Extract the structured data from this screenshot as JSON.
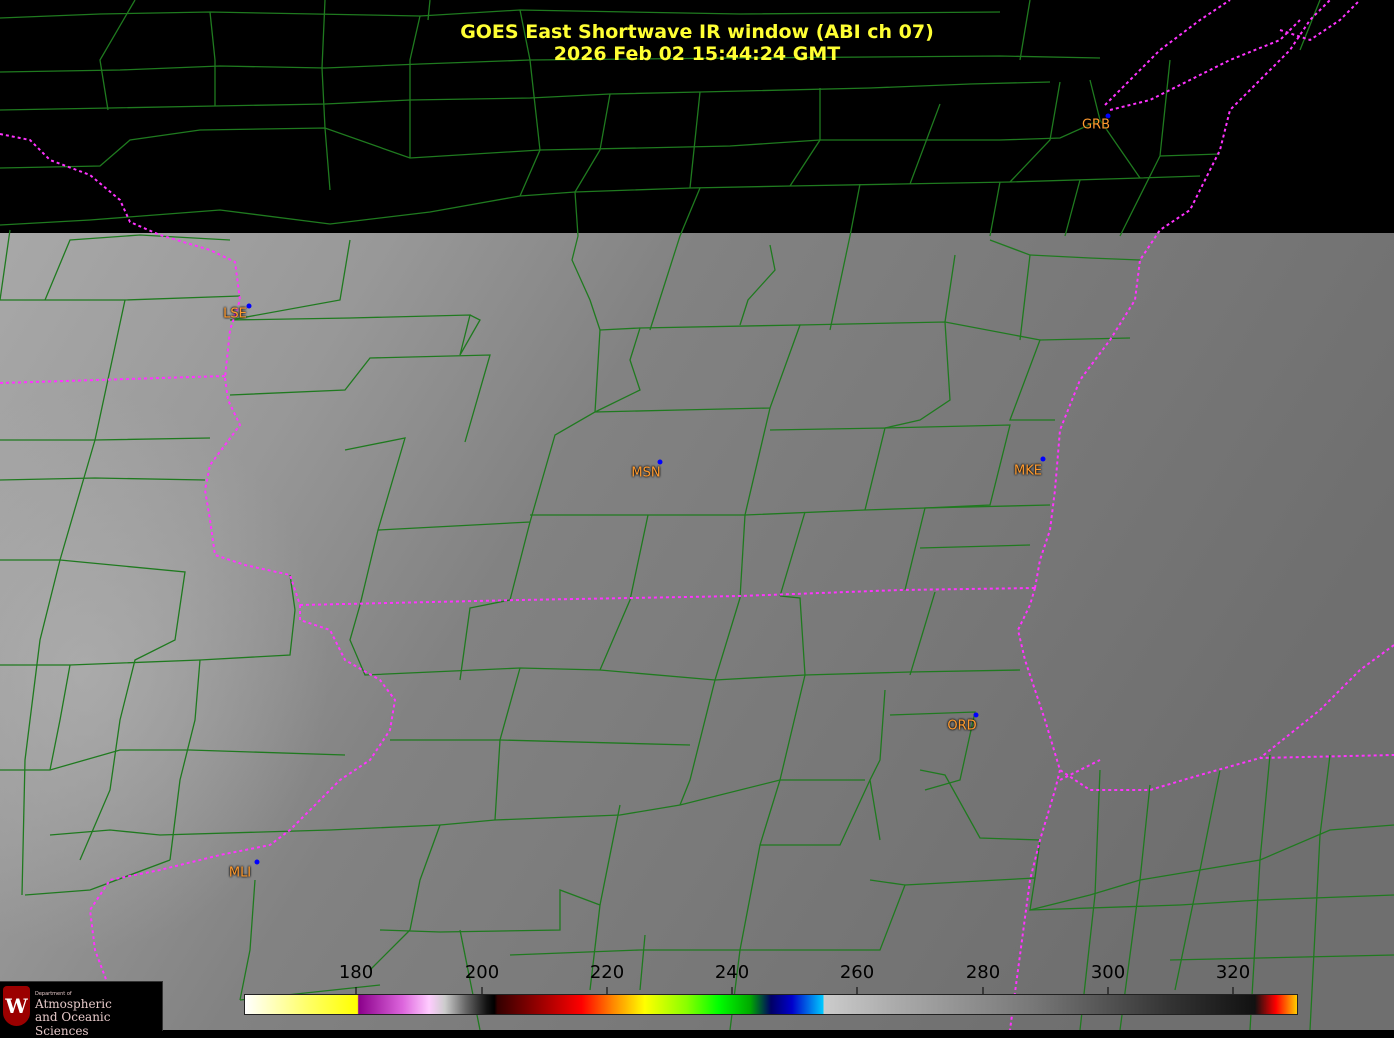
{
  "title": {
    "line1": "GOES East Shortwave IR window (ABI ch 07)",
    "line2": "2026 Feb 02  15:44:24 GMT"
  },
  "colors": {
    "county_lines": "#1f7a1f",
    "state_lines": "#ff33ff",
    "title_text": "#ffff33",
    "city_label": "#ff9a2e",
    "city_dot": "#0000ff"
  },
  "cities": [
    {
      "code": "GRB"
    },
    {
      "code": "LSE"
    },
    {
      "code": "MSN"
    },
    {
      "code": "MKE"
    },
    {
      "code": "ORD"
    },
    {
      "code": "MLI"
    }
  ],
  "colorbar": {
    "ticks": [
      "180",
      "200",
      "220",
      "240",
      "260",
      "280",
      "300",
      "320"
    ]
  },
  "logo": {
    "dept": "Department of",
    "line1": "Atmospheric",
    "line2": "and Oceanic Sciences",
    "shield_icon": "uw-crest-icon",
    "shield_letter": "W"
  }
}
